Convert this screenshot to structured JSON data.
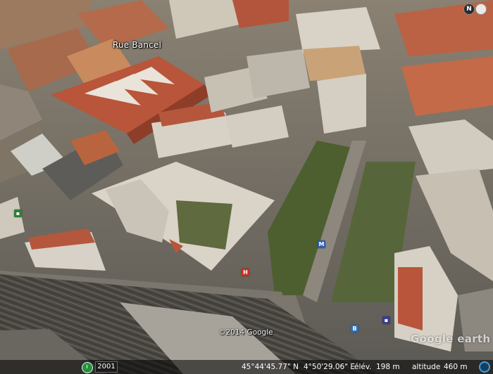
{
  "map": {
    "street_label": "Rue Bancel",
    "copyright": "©2014 Google",
    "watermark": "Google earth",
    "compass_label": "N"
  },
  "status": {
    "year": "2001",
    "lat": "45°44'45.77\" N",
    "lon": "4°50'29.06\" E",
    "elev_label": "élév.",
    "elev_value": "198 m",
    "alt_label": "altitude",
    "alt_value": "460 m"
  },
  "pins": [
    {
      "kind": "metro",
      "label": "M"
    },
    {
      "kind": "hospital",
      "label": "H"
    },
    {
      "kind": "bus",
      "label": "B"
    },
    {
      "kind": "station",
      "label": "▪"
    },
    {
      "kind": "tram",
      "label": "▪"
    }
  ],
  "colors": {
    "roof_terracotta": "#b8553a",
    "park_green": "#4d5f2f",
    "metro_blue": "#2f5fb3"
  }
}
